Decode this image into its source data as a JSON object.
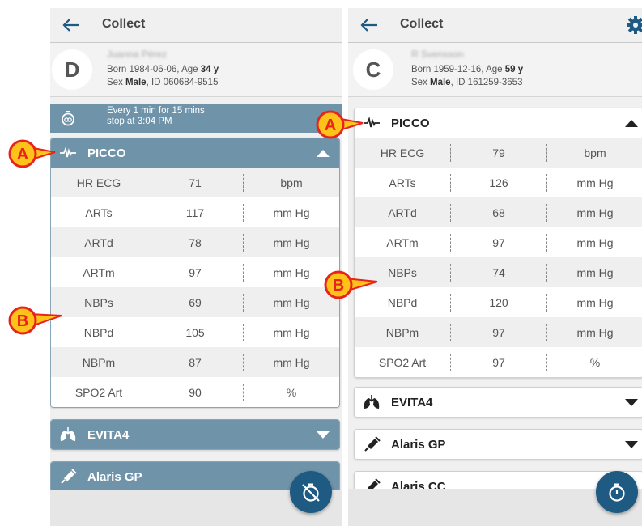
{
  "screens": [
    {
      "title": "Collect",
      "patient": {
        "initial": "D",
        "name": "Juanna Pérez",
        "born_prefix": "Born 1984-06-06, Age ",
        "age": "34 y",
        "sex_prefix": "Sex ",
        "sex": "Male",
        "id_text": ", ID 060684-9515"
      },
      "timer": {
        "line1": "Every 1 min for 15 mins",
        "line2": "stop at 3:04 PM"
      },
      "picco": {
        "label": "PICCO",
        "rows": [
          {
            "name": "HR ECG",
            "value": "71",
            "unit": "bpm"
          },
          {
            "name": "ARTs",
            "value": "117",
            "unit": "mm Hg"
          },
          {
            "name": "ARTd",
            "value": "78",
            "unit": "mm Hg"
          },
          {
            "name": "ARTm",
            "value": "97",
            "unit": "mm Hg"
          },
          {
            "name": "NBPs",
            "value": "69",
            "unit": "mm Hg"
          },
          {
            "name": "NBPd",
            "value": "105",
            "unit": "mm Hg"
          },
          {
            "name": "NBPm",
            "value": "87",
            "unit": "mm Hg"
          },
          {
            "name": "SPO2 Art",
            "value": "90",
            "unit": "%"
          }
        ]
      },
      "devices": [
        "EVITA4",
        "Alaris GP"
      ],
      "callouts": [
        "A",
        "B"
      ]
    },
    {
      "title": "Collect",
      "patient": {
        "initial": "C",
        "name": "R Svensson",
        "born_prefix": "Born 1959-12-16, Age ",
        "age": "59 y",
        "sex_prefix": "Sex ",
        "sex": "Male",
        "id_text": ", ID 161259-3653"
      },
      "picco": {
        "label": "PICCO",
        "rows": [
          {
            "name": "HR ECG",
            "value": "79",
            "unit": "bpm"
          },
          {
            "name": "ARTs",
            "value": "126",
            "unit": "mm Hg"
          },
          {
            "name": "ARTd",
            "value": "68",
            "unit": "mm Hg"
          },
          {
            "name": "ARTm",
            "value": "97",
            "unit": "mm Hg"
          },
          {
            "name": "NBPs",
            "value": "74",
            "unit": "mm Hg"
          },
          {
            "name": "NBPd",
            "value": "120",
            "unit": "mm Hg"
          },
          {
            "name": "NBPm",
            "value": "97",
            "unit": "mm Hg"
          },
          {
            "name": "SPO2 Art",
            "value": "97",
            "unit": "%"
          }
        ]
      },
      "devices": [
        "EVITA4",
        "Alaris GP",
        "Alaris CC"
      ],
      "callouts": [
        "A",
        "B"
      ]
    }
  ],
  "colors": {
    "header": "#6f93a9",
    "fab": "#1e5a82",
    "callout": "#e8231c",
    "callout_fill": "#ffc21a"
  },
  "icons": [
    "back-arrow-icon",
    "gear-icon",
    "stopwatch-icon",
    "waveform-icon",
    "lungs-icon",
    "syringe-icon",
    "stopwatch-off-icon"
  ]
}
